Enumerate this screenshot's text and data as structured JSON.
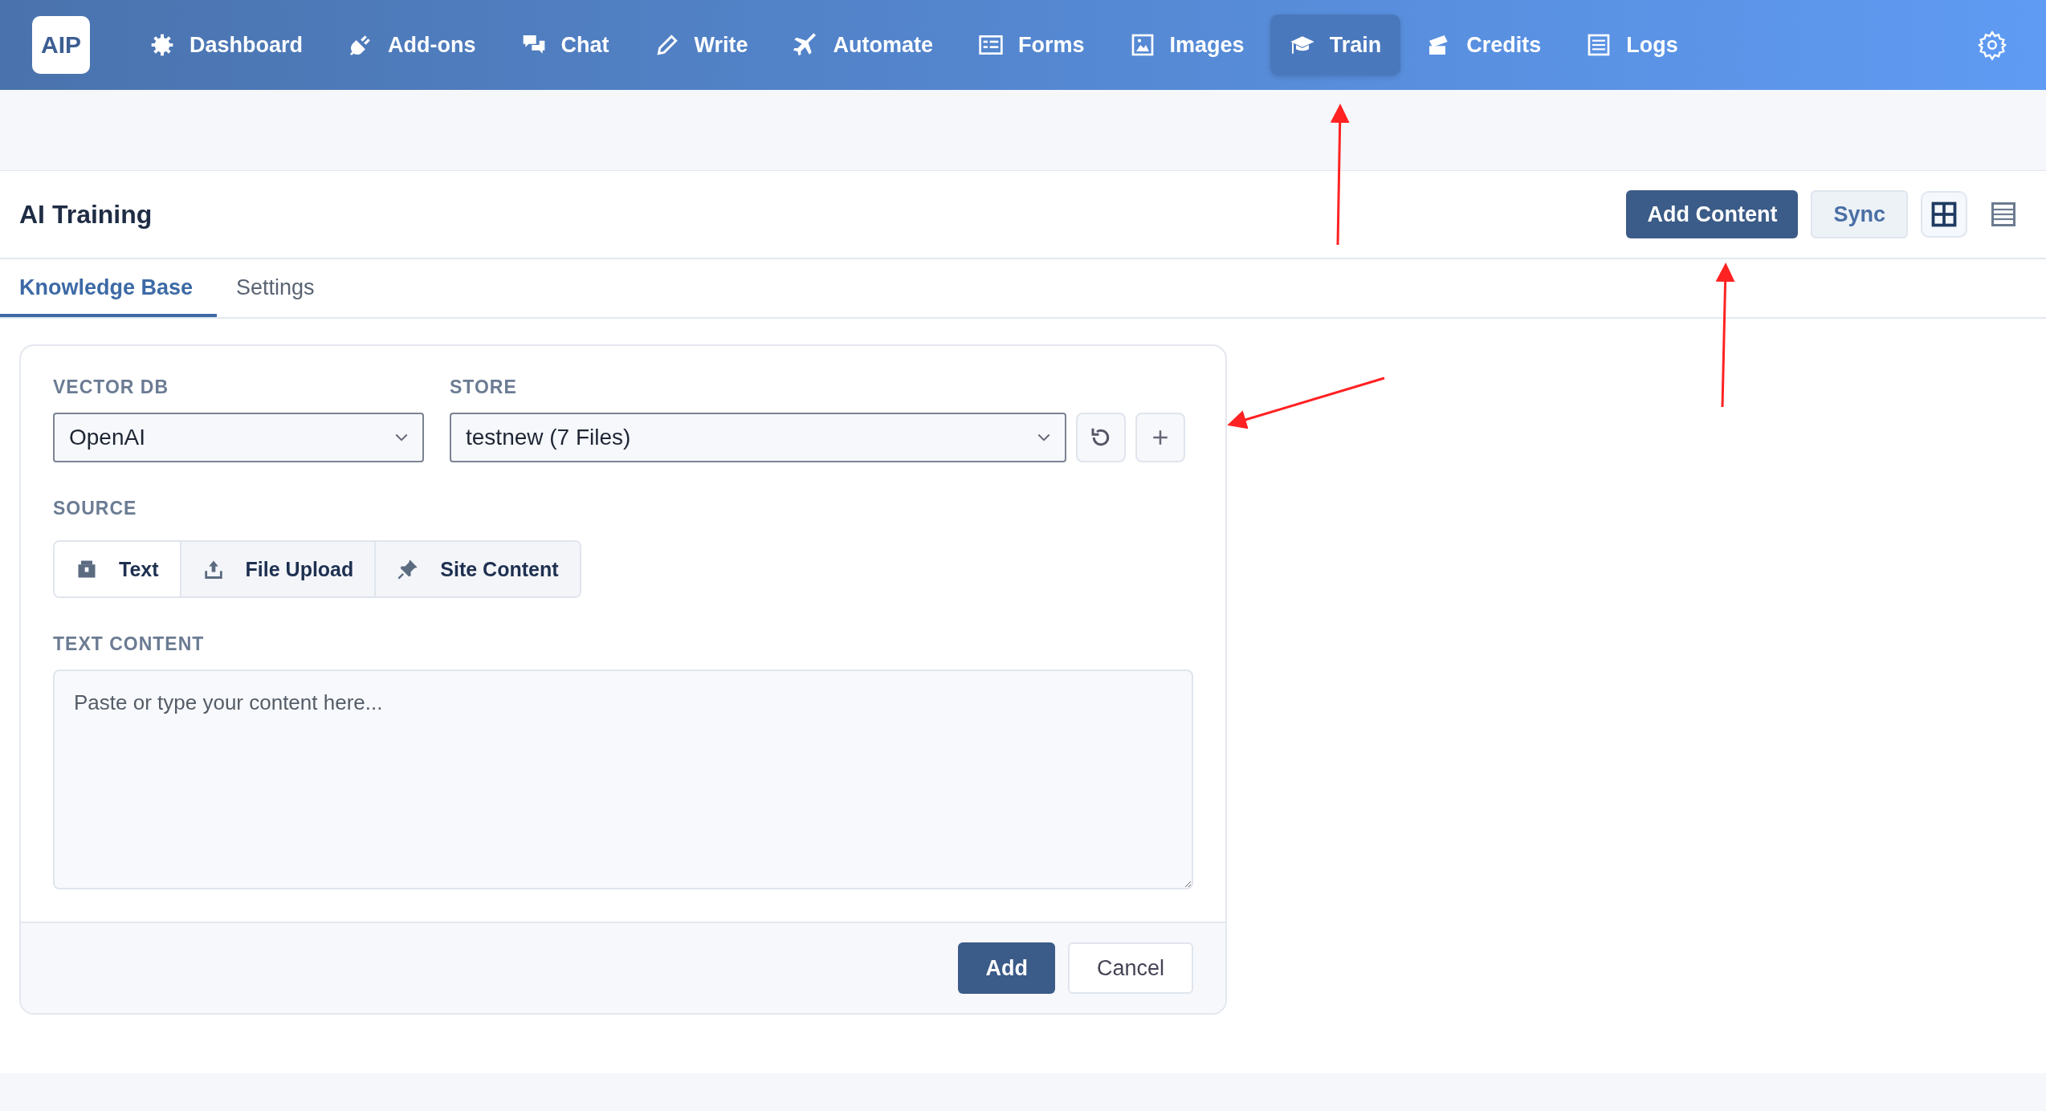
{
  "nav": {
    "logo": "AIP",
    "items": [
      {
        "label": "Dashboard",
        "selected": false
      },
      {
        "label": "Add-ons",
        "selected": false
      },
      {
        "label": "Chat",
        "selected": false
      },
      {
        "label": "Write",
        "selected": false
      },
      {
        "label": "Automate",
        "selected": false
      },
      {
        "label": "Forms",
        "selected": false
      },
      {
        "label": "Images",
        "selected": false
      },
      {
        "label": "Train",
        "selected": true
      },
      {
        "label": "Credits",
        "selected": false
      },
      {
        "label": "Logs",
        "selected": false
      }
    ]
  },
  "header": {
    "title": "AI Training",
    "buttons": [
      {
        "label": "Add Content",
        "kind": "primary"
      },
      {
        "label": "Sync",
        "kind": "secondary"
      }
    ],
    "views": [
      {
        "selected": true
      },
      {
        "selected": false
      }
    ]
  },
  "tabs": [
    {
      "label": "Knowledge Base",
      "selected": true
    },
    {
      "label": "Settings",
      "selected": false
    }
  ],
  "form": {
    "vector_db": {
      "label": "VECTOR DB",
      "value": "OpenAI"
    },
    "store": {
      "label": "STORE",
      "value": "testnew (7 Files)"
    },
    "source": {
      "label": "SOURCE",
      "options": [
        {
          "label": "Text",
          "selected": true
        },
        {
          "label": "File Upload",
          "selected": false
        },
        {
          "label": "Site Content",
          "selected": false
        }
      ]
    },
    "text_content": {
      "label": "TEXT CONTENT",
      "placeholder": "Paste or type your content here..."
    },
    "buttons": [
      {
        "label": "Add",
        "kind": "primary"
      },
      {
        "label": "Cancel",
        "kind": "secondary"
      }
    ]
  }
}
